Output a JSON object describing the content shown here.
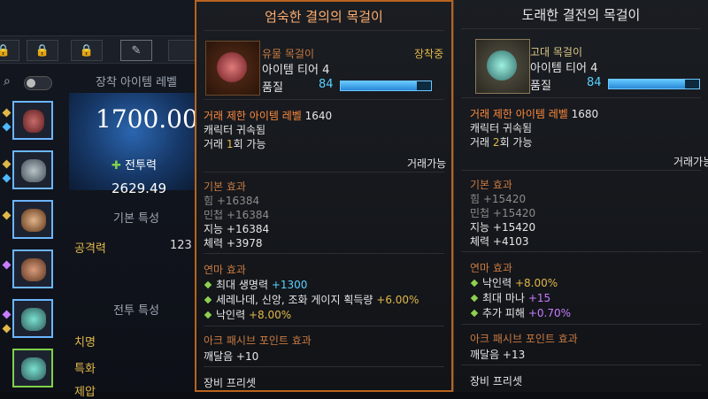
{
  "left_panel": {
    "header": "장착 아이템 레벨",
    "item_level": "1700.00",
    "combat_power_label": "전투력",
    "combat_power_value": "2629.49",
    "basic_stats_header": "기본 특성",
    "attack_label": "공격력",
    "attack_value": "123",
    "combat_stats_header": "전투 특성",
    "crit_label": "치명",
    "spec_label": "특화",
    "partial_label": "제압"
  },
  "tooltip_equipped": {
    "title": "엄숙한 결의의 목걸이",
    "grade": "유물 목걸이",
    "equipped_badge": "장착중",
    "tier": "아이템 티어 4",
    "quality_label": "품질",
    "quality_value": "84",
    "quality_fraction": 0.84,
    "req_label": "거래 제한 아이템 레벨",
    "req_value": "1640",
    "bound": "캐릭터 귀속됨",
    "trade_prefix": "거래",
    "trade_count": "1",
    "trade_suffix": "회 가능",
    "tradeable": "거래가능",
    "basic_header": "기본 효과",
    "basic": [
      "힘 +16384",
      "민첩 +16384",
      "지능 +16384",
      "체력 +3978"
    ],
    "refine_header": "연마 효과",
    "refine": [
      {
        "text": "최대 생명력",
        "value": "+1300"
      },
      {
        "text": "세레나데, 신앙, 조화 게이지 획득량",
        "value": "+6.00%"
      },
      {
        "text": "낙인력",
        "value": "+8.00%"
      }
    ],
    "ark_header": "아크 패시브 포인트 효과",
    "ark": "깨달음 +10",
    "preset": "장비 프리셋"
  },
  "tooltip_compare": {
    "title": "도래한 결전의 목걸이",
    "grade": "고대 목걸이",
    "tier": "아이템 티어 4",
    "quality_label": "품질",
    "quality_value": "84",
    "quality_fraction": 0.84,
    "req_label": "거래 제한 아이템 레벨",
    "req_value": "1680",
    "bound": "캐릭터 귀속됨",
    "trade_prefix": "거래",
    "trade_count": "2",
    "trade_suffix": "회 가능",
    "tradeable": "거래가능",
    "basic_header": "기본 효과",
    "basic": [
      "힘 +15420",
      "민첩 +15420",
      "지능 +15420",
      "체력 +4103"
    ],
    "refine_header": "연마 효과",
    "refine": [
      {
        "text": "낙인력",
        "value": "+8.00%"
      },
      {
        "text": "최대 마나",
        "value": "+15"
      },
      {
        "text": "추가 피해",
        "value": "+0.70%"
      }
    ],
    "ark_header": "아크 패시브 포인트 효과",
    "ark": "깨달음 +13",
    "preset": "장비 프리셋"
  },
  "colors": {
    "accent_orange": "#b8631e",
    "quality_blue": "#5ad0ff",
    "grade_relic": "#ff8a3c",
    "grade_ancient": "#e0c98a"
  },
  "icons": [
    "lock-icon",
    "edit-icon",
    "search-icon"
  ]
}
